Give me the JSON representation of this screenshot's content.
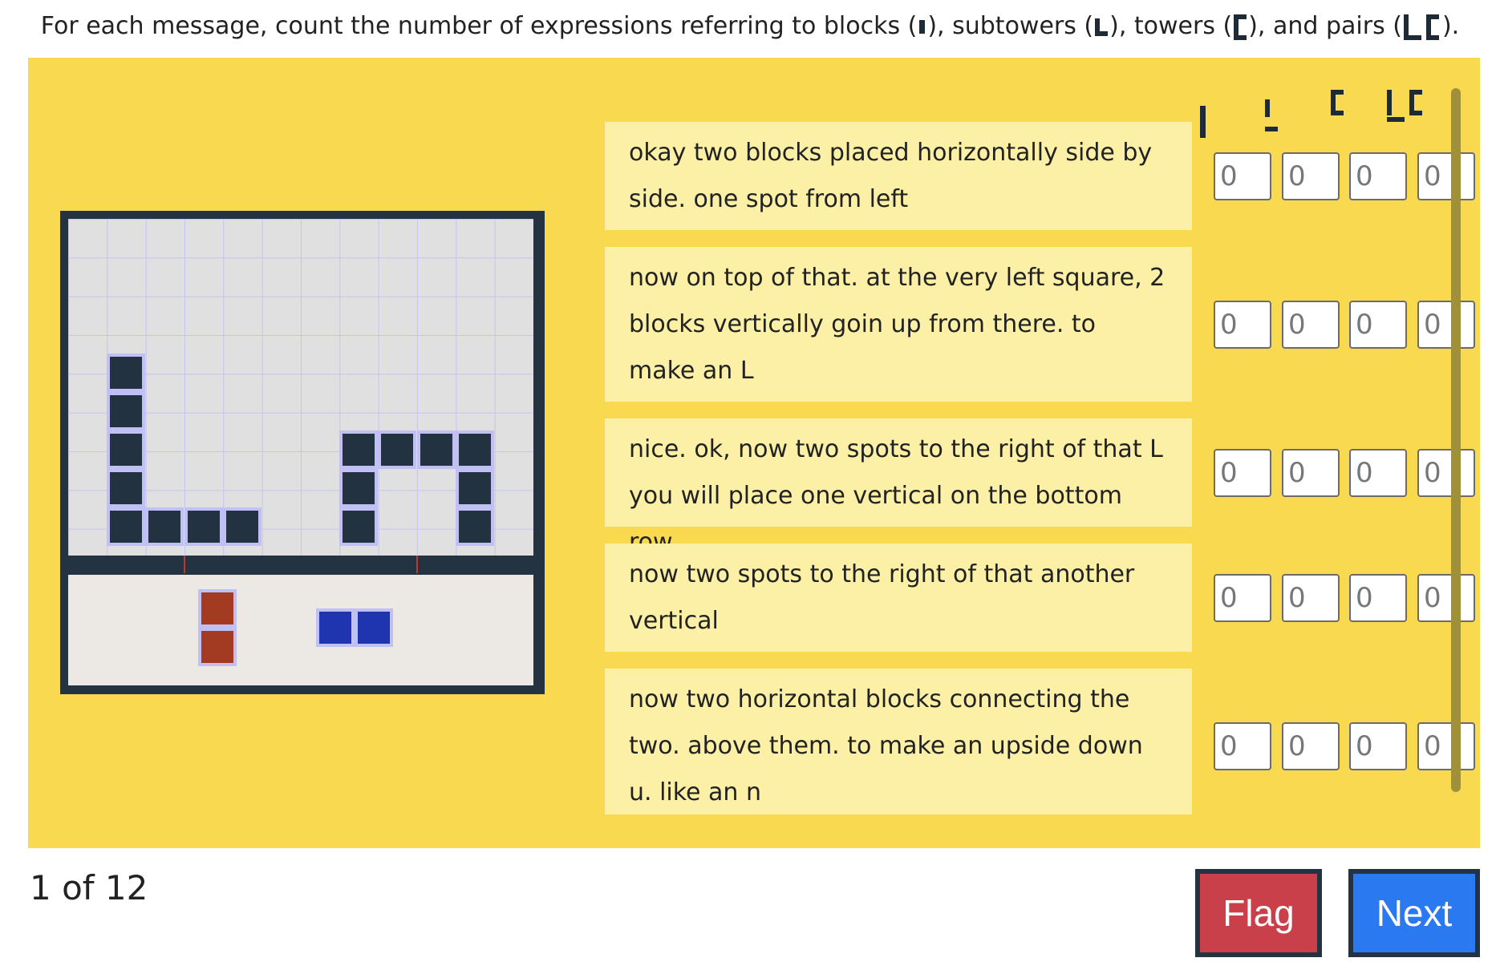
{
  "instruction": {
    "part1": "For each message, count the number of expressions referring to blocks (",
    "part2": "), subtowers (",
    "part3": "), towers (",
    "part4": "), and pairs (",
    "part5": ")."
  },
  "messages": [
    {
      "text": "okay two blocks placed horizontally side by side. one spot from left",
      "counts": {
        "blocks": "0",
        "subtowers": "0",
        "towers": "0",
        "pairs": "0"
      }
    },
    {
      "text": "now on top of that. at the very left square, 2 blocks vertically goin up from there. to make an L",
      "counts": {
        "blocks": "0",
        "subtowers": "0",
        "towers": "0",
        "pairs": "0"
      }
    },
    {
      "text": "nice. ok, now two spots to the right of that L you will place one vertical on the bottom row",
      "counts": {
        "blocks": "0",
        "subtowers": "0",
        "towers": "0",
        "pairs": "0"
      }
    },
    {
      "text": "now two spots to the right of that another vertical",
      "counts": {
        "blocks": "0",
        "subtowers": "0",
        "towers": "0",
        "pairs": "0"
      }
    },
    {
      "text": "now two horizontal blocks connecting the two. above them. to make an upside down u. like an n",
      "counts": {
        "blocks": "0",
        "subtowers": "0",
        "towers": "0",
        "pairs": "0"
      }
    }
  ],
  "footer": {
    "page_count": "1 of 12",
    "flag_label": "Flag",
    "next_label": "Next"
  },
  "colors": {
    "panel": "#f8d94f",
    "message_bg": "#fbf0a6",
    "block_dark": "#223240",
    "tray_red": "#a33a22",
    "tray_blue": "#1f35b0",
    "flag": "#c9404a",
    "next": "#2a79f0"
  },
  "icons": [
    "block-icon",
    "subtower-icon",
    "tower-icon",
    "pair-icon"
  ]
}
